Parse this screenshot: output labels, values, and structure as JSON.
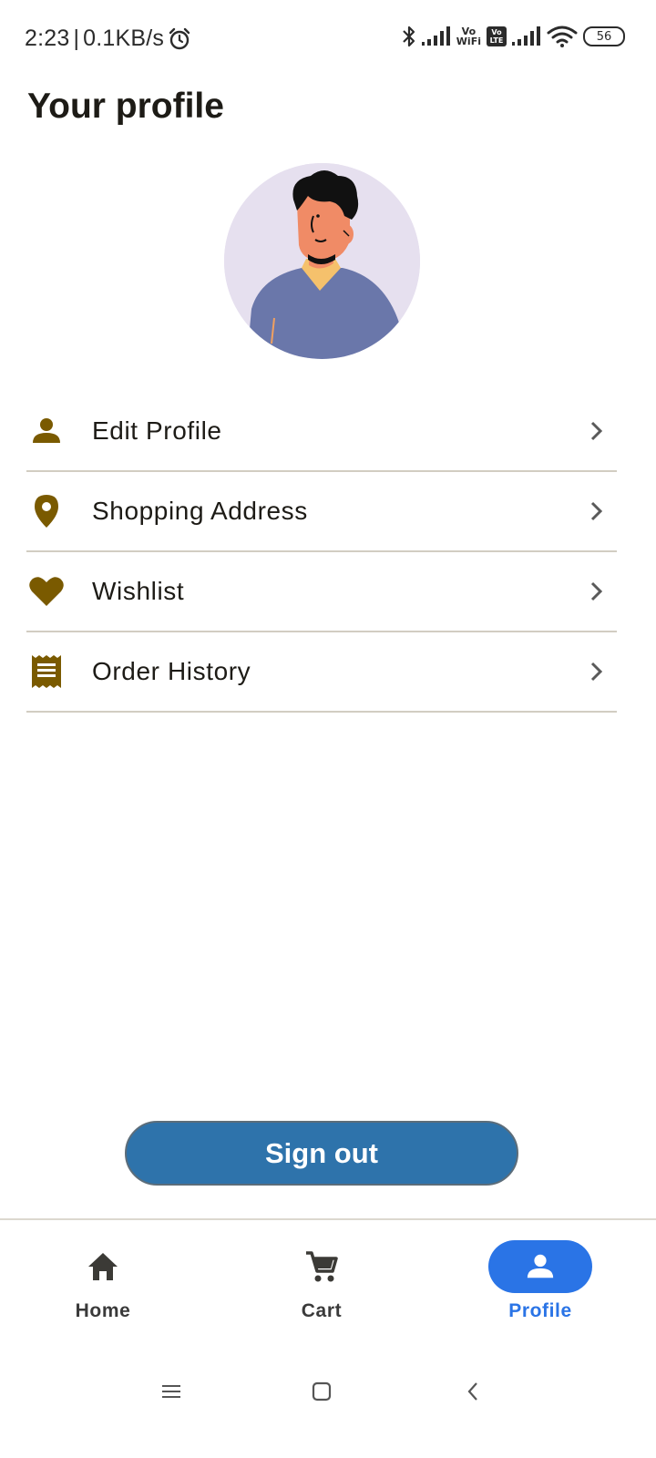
{
  "status_bar": {
    "time": "2:23",
    "separator": "|",
    "net_speed": "0.1KB/s",
    "vowifi_top": "Vo",
    "vowifi_bottom": "WiFi",
    "volte_top": "Vo",
    "volte_bottom": "LTE",
    "battery": "56"
  },
  "header": {
    "title": "Your profile"
  },
  "menu": {
    "items": [
      {
        "label": "Edit Profile",
        "icon": "person-icon"
      },
      {
        "label": "Shopping Address",
        "icon": "location-pin-icon"
      },
      {
        "label": "Wishlist",
        "icon": "heart-icon"
      },
      {
        "label": "Order History",
        "icon": "receipt-icon"
      }
    ]
  },
  "actions": {
    "sign_out_label": "Sign out"
  },
  "bottom_nav": {
    "items": [
      {
        "label": "Home",
        "icon": "home-icon",
        "active": false
      },
      {
        "label": "Cart",
        "icon": "cart-icon",
        "active": false
      },
      {
        "label": "Profile",
        "icon": "person-icon",
        "active": true
      }
    ]
  },
  "colors": {
    "accent_brown": "#7a5a00",
    "sign_out_blue": "#2e73ab",
    "nav_active_blue": "#2a74e6",
    "divider": "#d2cdc2"
  }
}
